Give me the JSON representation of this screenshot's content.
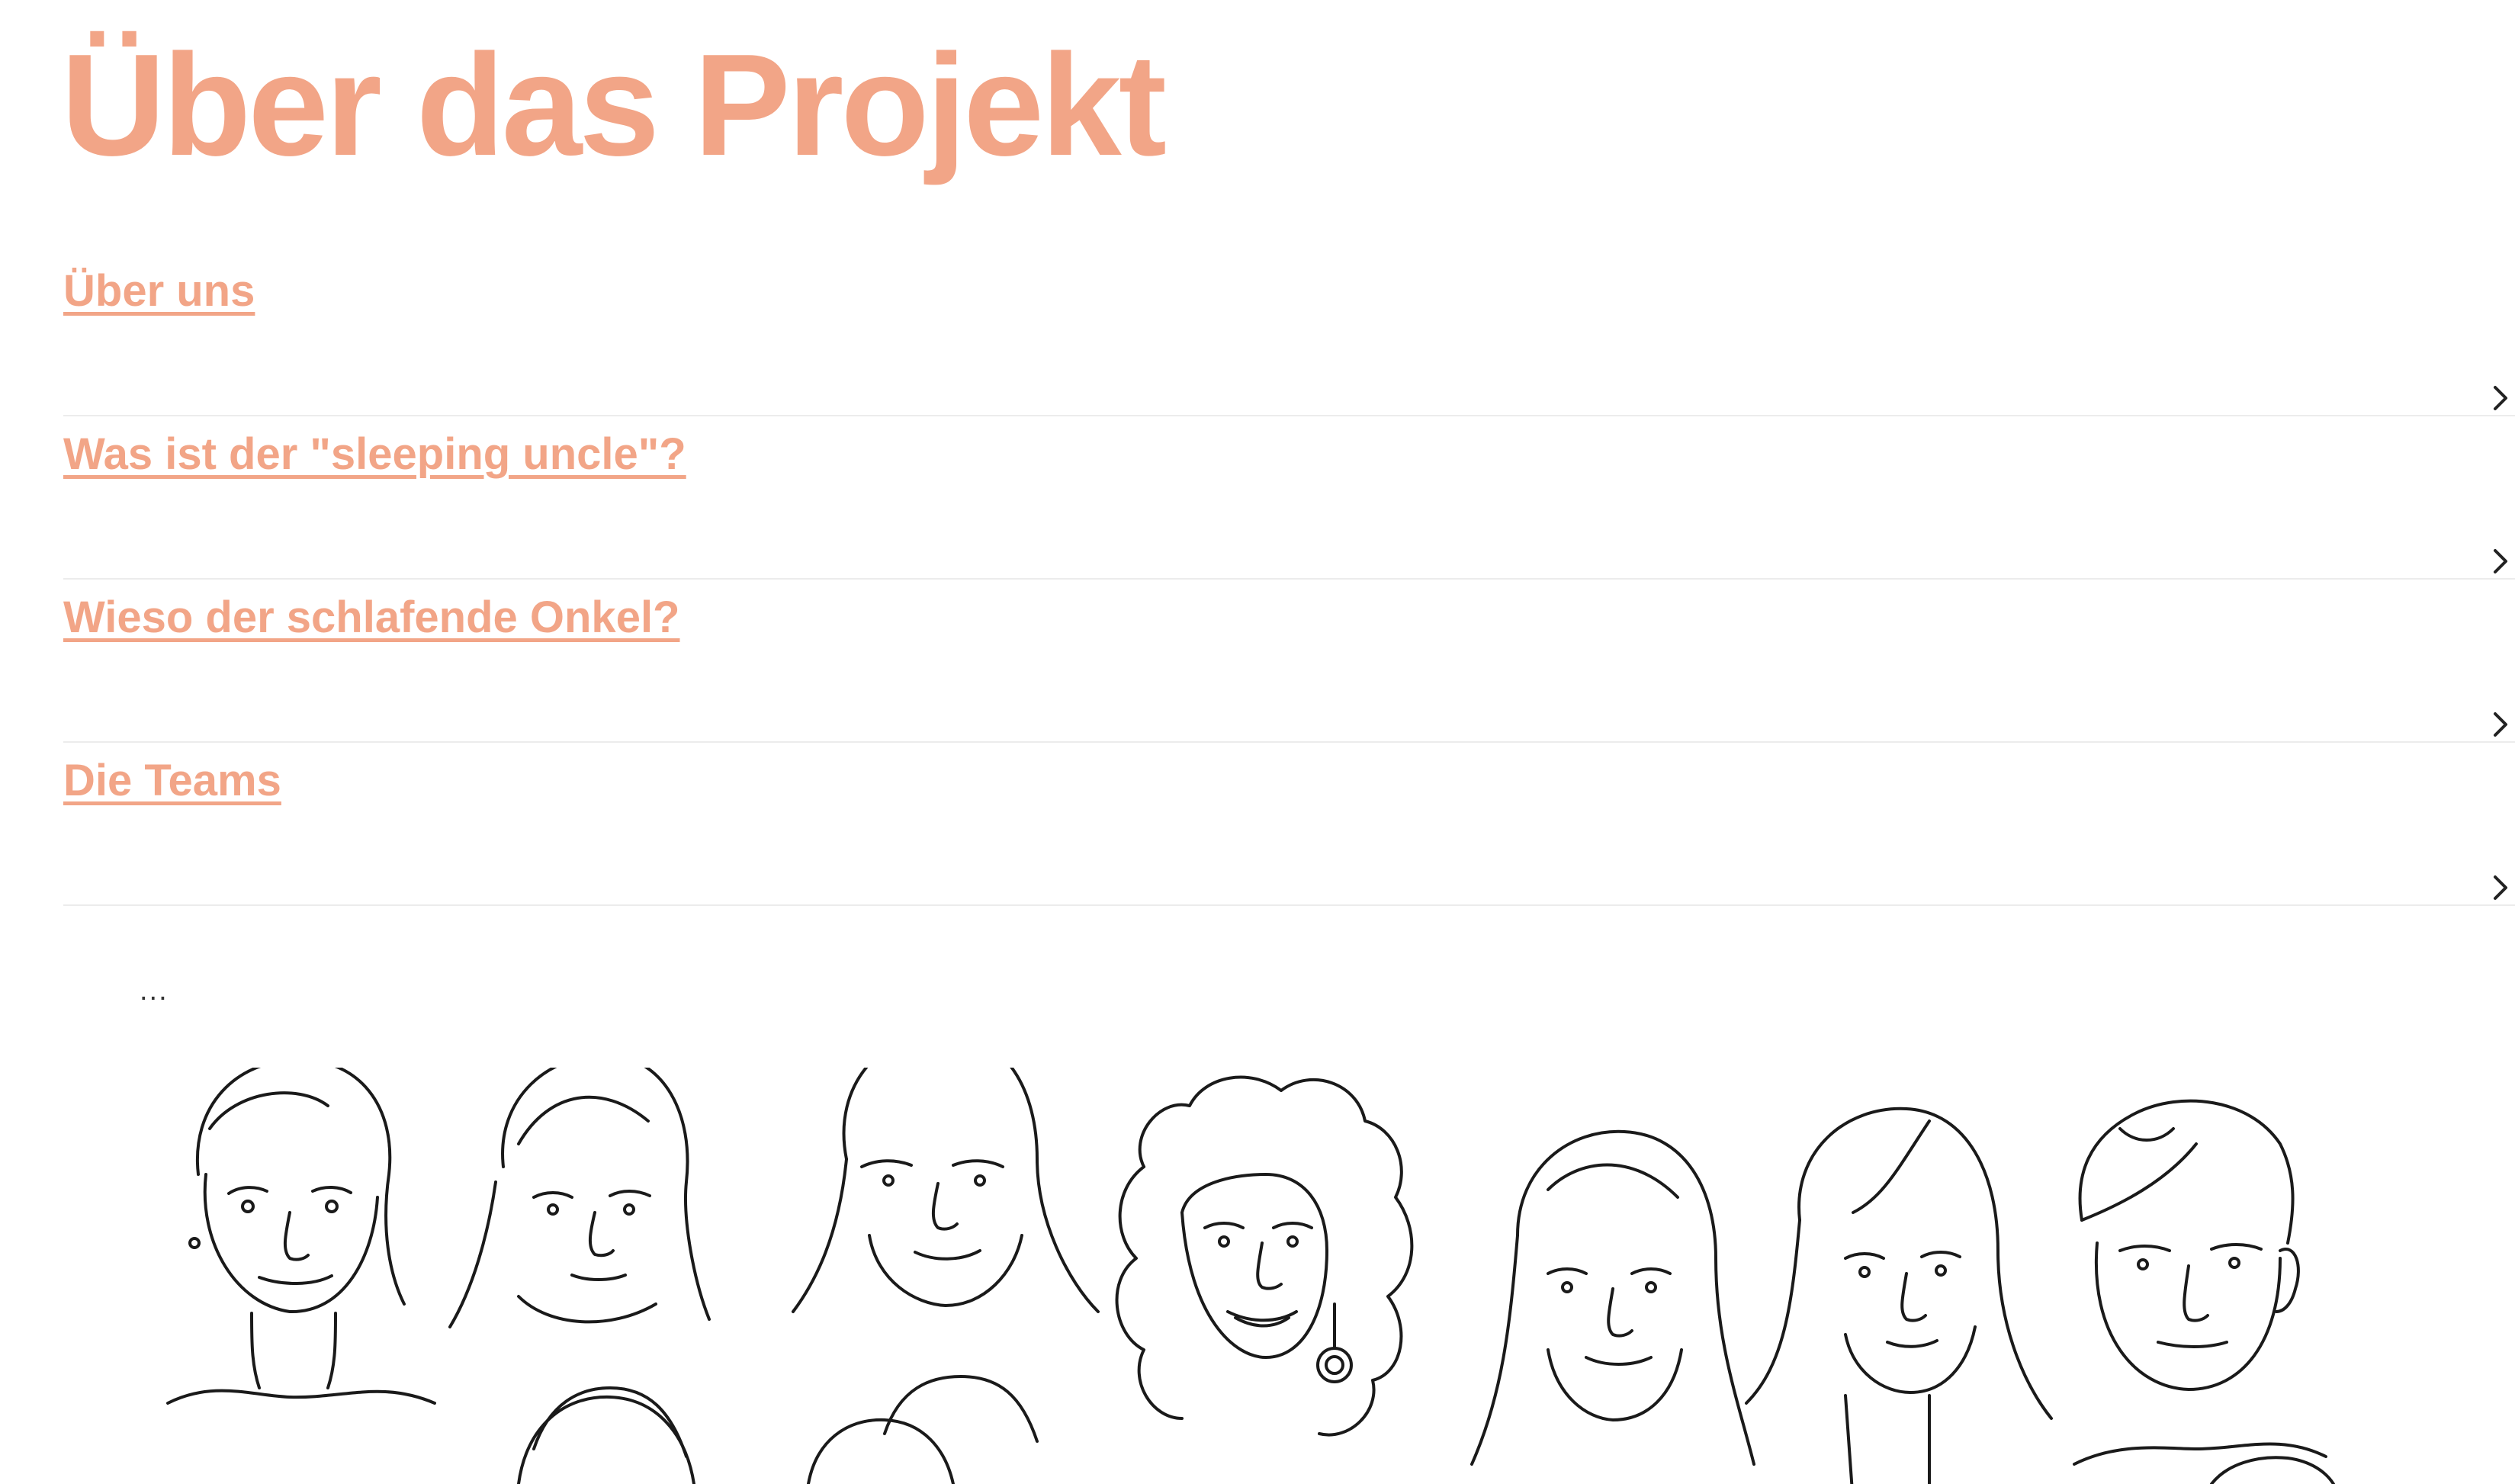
{
  "page": {
    "title": "Über das Projekt",
    "accent_color": "#f2a587"
  },
  "accordion": {
    "items": [
      {
        "label": "Über uns",
        "icon": "chevron-right-icon"
      },
      {
        "label": "Was ist der \"sleeping uncle\"?",
        "icon": "chevron-right-icon"
      },
      {
        "label": "Wieso der schlafende Onkel?",
        "icon": "chevron-right-icon"
      },
      {
        "label": "Die Teams",
        "icon": "chevron-right-icon"
      }
    ]
  },
  "content": {
    "ellipsis": "..."
  },
  "illustration": {
    "name": "team-portraits-line-drawing",
    "people_count": 7
  }
}
